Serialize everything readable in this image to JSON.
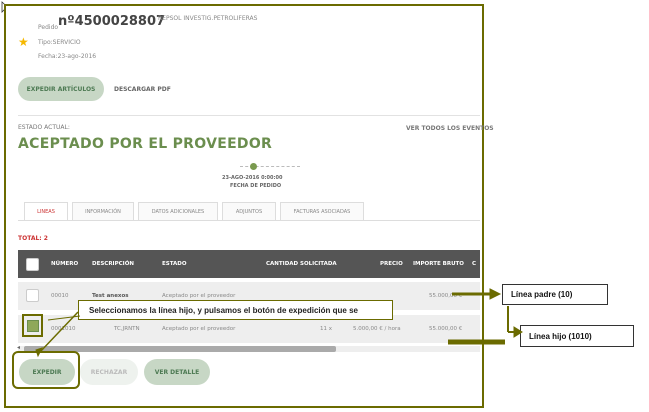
{
  "order": {
    "pedido_prefix": "Pedido",
    "number": "nº4500028807",
    "supplier": "REPSOL INVESTIG.PETROLIFERAS",
    "tipo": "Tipo:SERVICIO",
    "fecha": "Fecha:23-ago-2016"
  },
  "actions_top": {
    "expedir_articulos": "EXPEDIR ARTÍCULOS",
    "descargar_pdf": "DESCARGAR PDF"
  },
  "status": {
    "label": "ESTADO ACTUAL:",
    "value": "ACEPTADO POR EL PROVEEDOR",
    "ver_eventos": "VER TODOS LOS EVENTOS"
  },
  "timeline": {
    "date": "23-AGO-2016 0:00:00",
    "label": "FECHA DE PEDIDO"
  },
  "tabs": [
    {
      "label": "LINEAS",
      "active": true
    },
    {
      "label": "INFORMACIÓN",
      "active": false
    },
    {
      "label": "DATOS ADICIONALES",
      "active": false
    },
    {
      "label": "ADJUNTOS",
      "active": false
    },
    {
      "label": "FACTURAS ASOCIADAS",
      "active": false
    }
  ],
  "total": "TOTAL:  2",
  "table": {
    "headers": [
      "NÚMERO",
      "DESCRIPCIÓN",
      "ESTADO",
      "CANTIDAD SOLICITADA",
      "PRECIO",
      "IMPORTE BRUTO",
      "C"
    ],
    "rows": [
      {
        "numero": "00010",
        "descripcion": "Test anexos",
        "estado": "Aceptado por el proveedor",
        "cantidad": "",
        "precio": "",
        "importe": "55.000,00 €"
      },
      {
        "numero": "0001010",
        "descripcion": "TC,JRNTN",
        "estado": "Aceptado por el proveedor",
        "cantidad": "11 x",
        "precio": "5.000,00 € / hora",
        "importe": "55.000,00 €"
      }
    ]
  },
  "callout": "Seleccionamos la línea hijo, y pulsamos el botón de expedición que se",
  "bottom_buttons": {
    "expedir": "EXPEDIR",
    "rechazar": "RECHAZAR",
    "ver_detalle": "VER DETALLE"
  },
  "annotations": {
    "padre": "Línea padre (10)",
    "hijo": "Línea hijo (1010)"
  },
  "colors": {
    "accent_green": "#6b8e4e",
    "annotation_olive": "#6b6b00",
    "header_dark": "#555555",
    "total_red": "#cc3333"
  }
}
